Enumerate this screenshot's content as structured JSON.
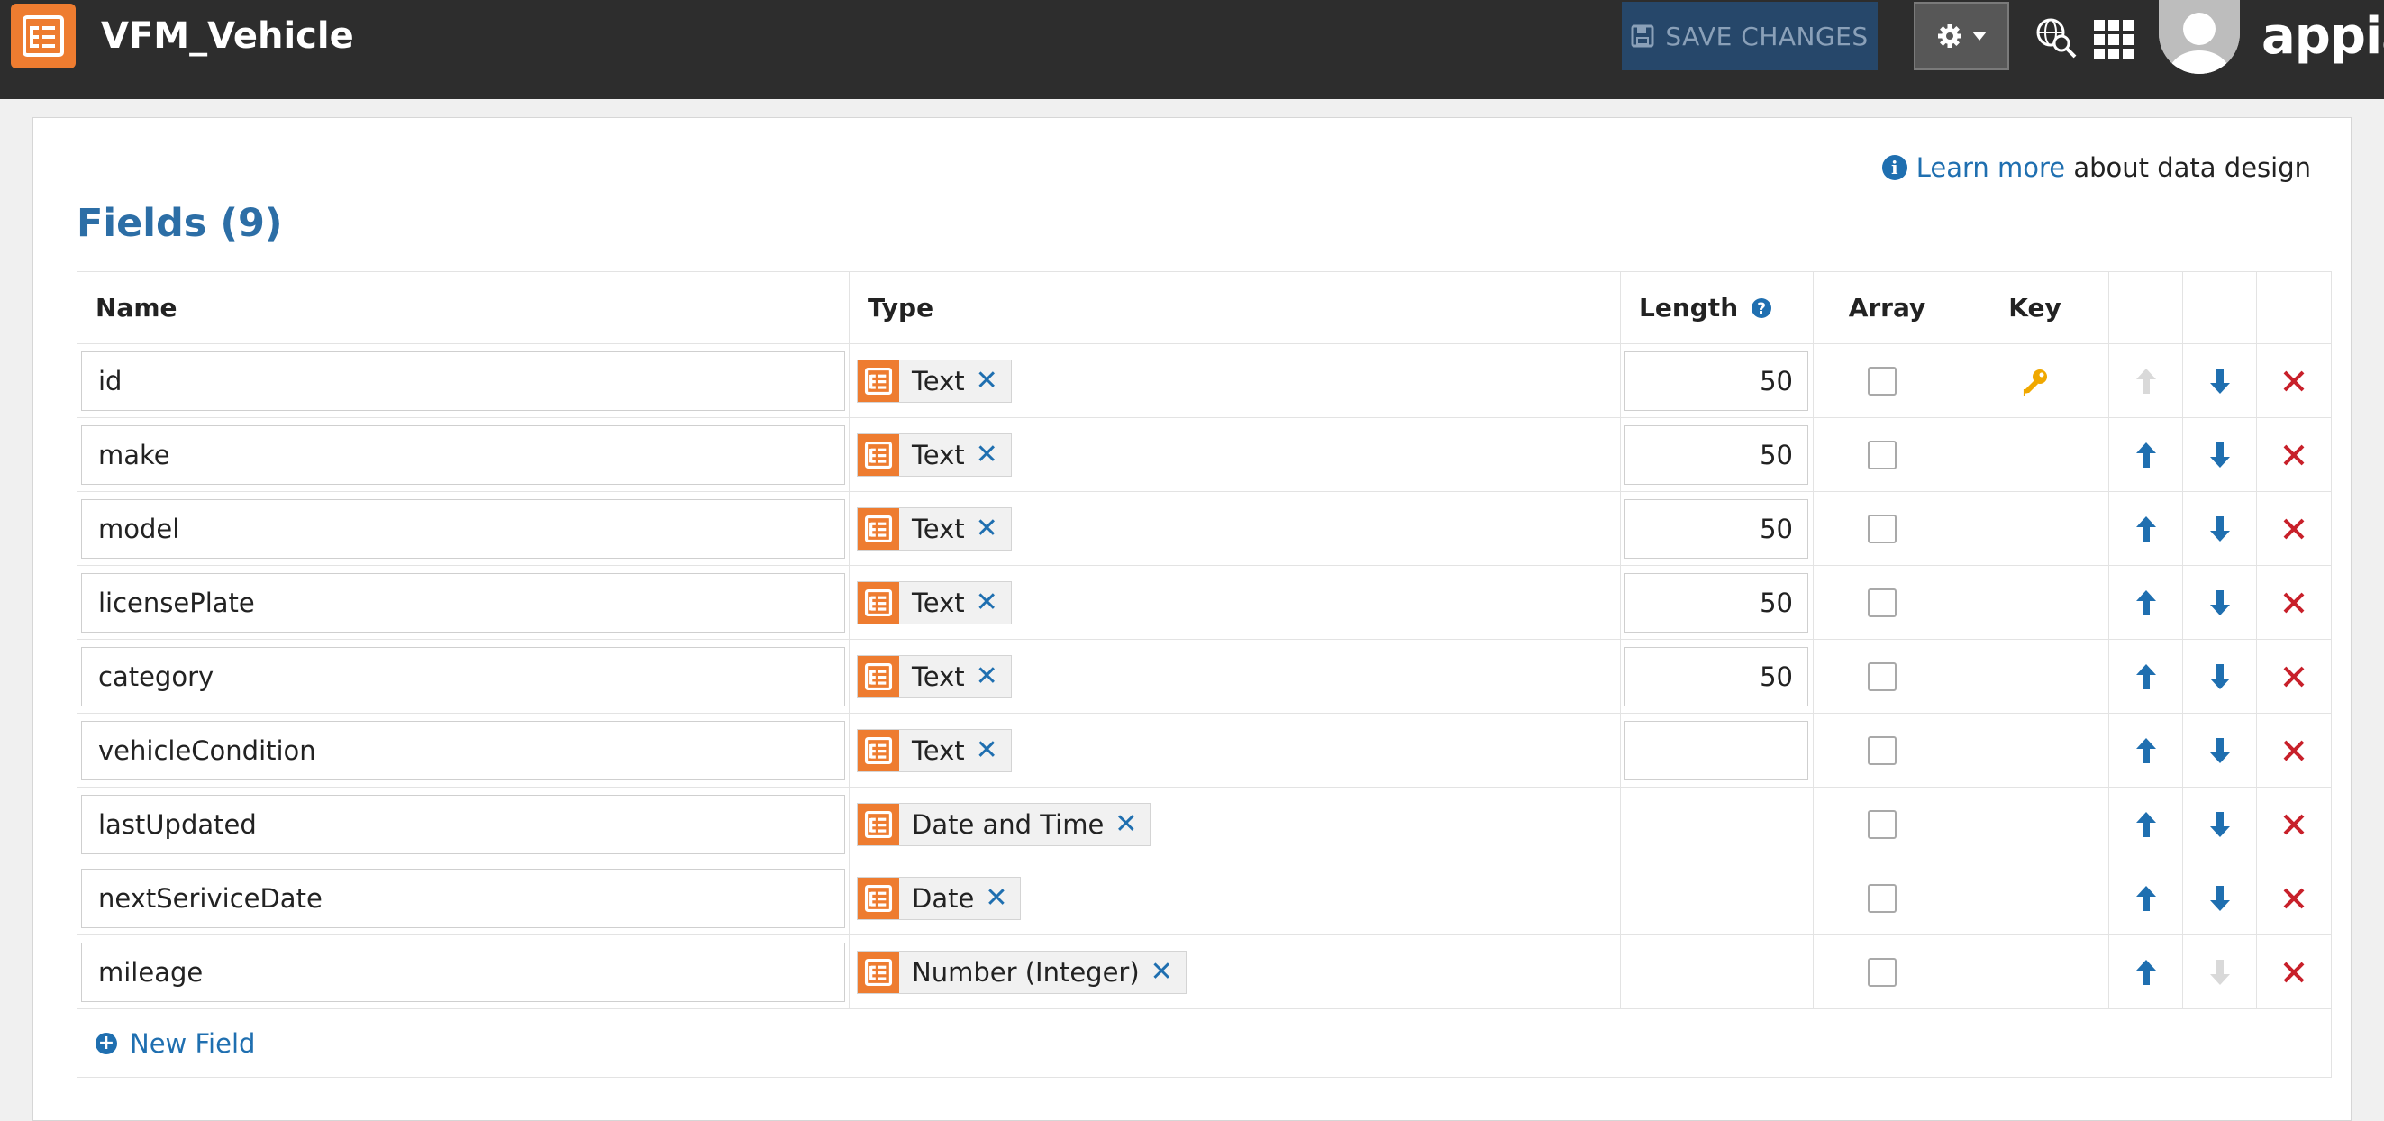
{
  "header": {
    "title": "VFM_Vehicle",
    "save_label": "SAVE CHANGES",
    "brand": "appiar"
  },
  "learn_more": {
    "link_text": "Learn more",
    "rest": "about data design"
  },
  "fields_title": "Fields (9)",
  "columns": {
    "name": "Name",
    "type": "Type",
    "length": "Length",
    "array": "Array",
    "key": "Key"
  },
  "rows": [
    {
      "name": "id",
      "type": "Text",
      "length": "50",
      "array": false,
      "key": true,
      "up_enabled": false,
      "down_enabled": true
    },
    {
      "name": "make",
      "type": "Text",
      "length": "50",
      "array": false,
      "key": false,
      "up_enabled": true,
      "down_enabled": true
    },
    {
      "name": "model",
      "type": "Text",
      "length": "50",
      "array": false,
      "key": false,
      "up_enabled": true,
      "down_enabled": true
    },
    {
      "name": "licensePlate",
      "type": "Text",
      "length": "50",
      "array": false,
      "key": false,
      "up_enabled": true,
      "down_enabled": true
    },
    {
      "name": "category",
      "type": "Text",
      "length": "50",
      "array": false,
      "key": false,
      "up_enabled": true,
      "down_enabled": true
    },
    {
      "name": "vehicleCondition",
      "type": "Text",
      "length": "",
      "array": false,
      "key": false,
      "up_enabled": true,
      "down_enabled": true
    },
    {
      "name": "lastUpdated",
      "type": "Date and Time",
      "length": null,
      "array": false,
      "key": false,
      "up_enabled": true,
      "down_enabled": true
    },
    {
      "name": "nextSeriviceDate",
      "type": "Date",
      "length": null,
      "array": false,
      "key": false,
      "up_enabled": true,
      "down_enabled": true
    },
    {
      "name": "mileage",
      "type": "Number (Integer)",
      "length": null,
      "array": false,
      "key": false,
      "up_enabled": true,
      "down_enabled": false
    }
  ],
  "new_field_label": "New Field",
  "colors": {
    "accent": "#1f6fb0",
    "title": "#2c6ea6",
    "orange": "#ee7c30",
    "delete": "#c8202a",
    "key": "#f0a800",
    "topbar": "#2d2d2d",
    "save_button": "#26476a"
  },
  "icons": {
    "app": "record-type-icon",
    "save": "floppy-disk-icon",
    "settings": "gear-icon",
    "search": "globe-search-icon",
    "apps": "grid-icon",
    "info": "info-icon",
    "help": "question-circle-icon",
    "key": "key-icon",
    "move_up": "arrow-up-icon",
    "move_down": "arrow-down-icon",
    "delete": "close-x-icon",
    "add": "plus-circle-icon"
  }
}
